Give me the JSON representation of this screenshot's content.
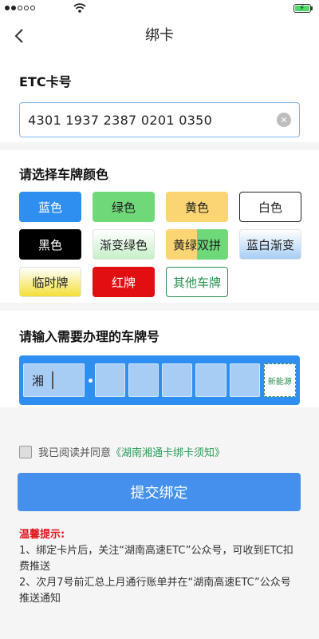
{
  "nav": {
    "title": "绑卡"
  },
  "etc": {
    "title": "ETC卡号",
    "value": "4301 1937 2387 0201 0350"
  },
  "plate_color": {
    "title": "请选择车牌颜色",
    "options": [
      "蓝色",
      "绿色",
      "黄色",
      "白色",
      "黑色",
      "渐变绿色",
      "黄绿双拼",
      "蓝白渐变",
      "临时牌",
      "红牌",
      "其他车牌"
    ]
  },
  "plate_number": {
    "title": "请输入需要办理的车牌号",
    "province": "湘",
    "new_energy_label": "新能源"
  },
  "agreement": {
    "prefix": "我已阅读并同意",
    "link": "《湖南湘通卡绑卡须知》"
  },
  "submit": {
    "label": "提交绑定"
  },
  "tips": {
    "title": "温馨提示:",
    "items": [
      "1、绑定卡片后，关注“湖南高速ETC”公众号，可收到ETC扣费推送",
      "2、次月7号前汇总上月通行账单并在“湖南高速ETC”公众号推送通知"
    ]
  },
  "colors": {
    "accent_blue": "#2f8ff0",
    "submit_blue": "#4590ed",
    "link_green": "#2a9a55",
    "tip_red": "#e0161c"
  },
  "icons": [
    "signal-icon",
    "wifi-icon",
    "battery-icon",
    "back-icon",
    "clear-icon"
  ]
}
